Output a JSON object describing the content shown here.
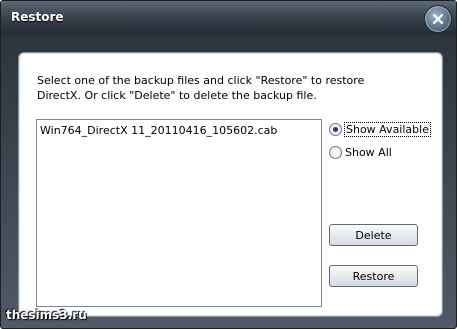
{
  "window": {
    "title": "Restore"
  },
  "icons": {
    "close": "close-icon"
  },
  "dialog": {
    "instructions": "Select one of the backup files and click \"Restore\" to restore\nDirectX. Or click \"Delete\" to delete the backup file.",
    "backup_files": [
      "Win764_DirectX 11_20110416_105602.cab"
    ],
    "radio_options": [
      {
        "label": "Show Available",
        "checked": true
      },
      {
        "label": "Show All",
        "checked": false
      }
    ],
    "buttons": {
      "delete": "Delete",
      "restore": "Restore"
    }
  },
  "watermark": "thesims3.ru",
  "colors": {
    "titlebar": "#2c343d",
    "panel_bg": "#ffffff",
    "radio_dot": "#1d3f7a"
  }
}
